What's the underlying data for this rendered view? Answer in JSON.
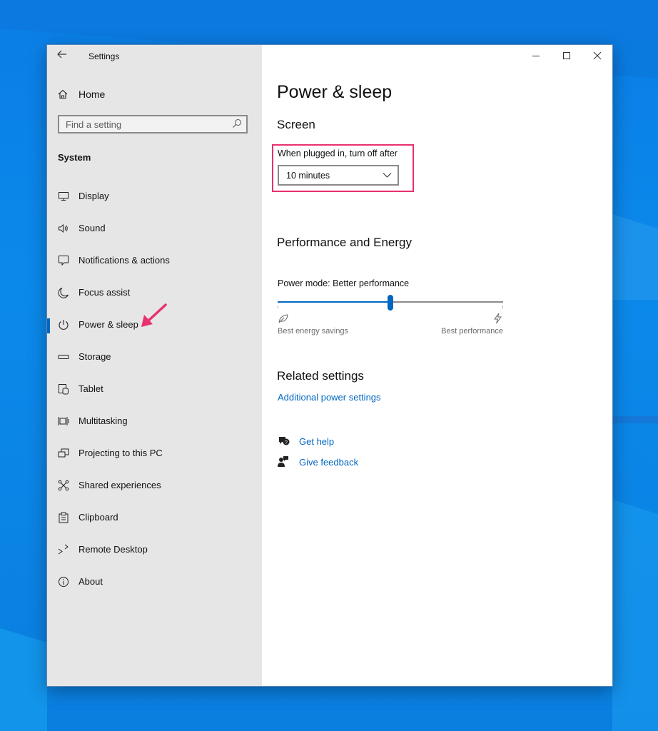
{
  "window": {
    "title": "Settings",
    "controls": {
      "minimize_icon": "minimize-icon",
      "maximize_icon": "maximize-icon",
      "close_icon": "close-icon"
    }
  },
  "sidebar": {
    "home_label": "Home",
    "search_placeholder": "Find a setting",
    "section_title": "System",
    "items": [
      {
        "label": "Display",
        "icon": "display-icon"
      },
      {
        "label": "Sound",
        "icon": "sound-icon"
      },
      {
        "label": "Notifications & actions",
        "icon": "notifications-icon"
      },
      {
        "label": "Focus assist",
        "icon": "moon-icon"
      },
      {
        "label": "Power & sleep",
        "icon": "power-icon",
        "selected": true
      },
      {
        "label": "Storage",
        "icon": "storage-icon"
      },
      {
        "label": "Tablet",
        "icon": "tablet-icon"
      },
      {
        "label": "Multitasking",
        "icon": "multitasking-icon"
      },
      {
        "label": "Projecting to this PC",
        "icon": "projecting-icon"
      },
      {
        "label": "Shared experiences",
        "icon": "shared-icon"
      },
      {
        "label": "Clipboard",
        "icon": "clipboard-icon"
      },
      {
        "label": "Remote Desktop",
        "icon": "remote-desktop-icon"
      },
      {
        "label": "About",
        "icon": "info-icon"
      }
    ]
  },
  "main": {
    "page_title": "Power & sleep",
    "screen": {
      "heading": "Screen",
      "plugged_label": "When plugged in, turn off after",
      "plugged_value": "10 minutes"
    },
    "performance": {
      "heading": "Performance and Energy",
      "mode_label": "Power mode: Better performance",
      "slider_fraction": 0.5,
      "left_caption": "Best energy savings",
      "right_caption": "Best performance"
    },
    "related": {
      "heading": "Related settings",
      "link": "Additional power settings"
    },
    "help": {
      "get_help": "Get help",
      "give_feedback": "Give feedback"
    }
  },
  "colors": {
    "accent": "#0067c0",
    "highlight": "#e8316e",
    "annotation_arrow": "#e8316e"
  }
}
